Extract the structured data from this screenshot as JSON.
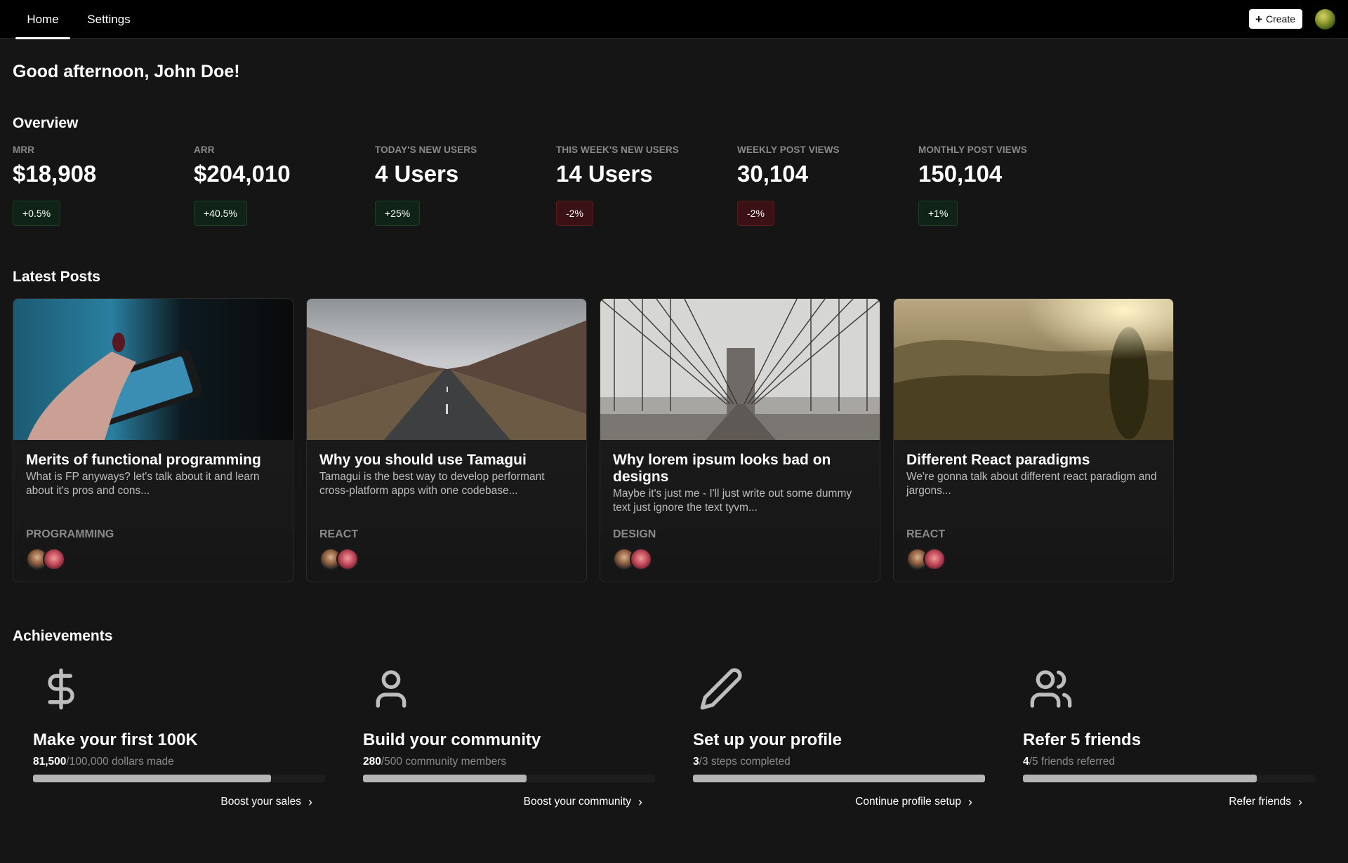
{
  "nav": {
    "tabs": [
      {
        "label": "Home",
        "active": true
      },
      {
        "label": "Settings",
        "active": false
      }
    ],
    "create_label": "Create",
    "create_icon": "plus-icon"
  },
  "greeting": "Good afternoon, John Doe!",
  "overview": {
    "title": "Overview",
    "stats": [
      {
        "label": "MRR",
        "value": "$18,908",
        "change": "+0.5%",
        "trend": "positive"
      },
      {
        "label": "ARR",
        "value": "$204,010",
        "change": "+40.5%",
        "trend": "positive"
      },
      {
        "label": "TODAY'S NEW USERS",
        "value": "4 Users",
        "change": "+25%",
        "trend": "positive"
      },
      {
        "label": "THIS WEEK'S NEW USERS",
        "value": "14 Users",
        "change": "-2%",
        "trend": "negative"
      },
      {
        "label": "WEEKLY POST VIEWS",
        "value": "30,104",
        "change": "-2%",
        "trend": "negative"
      },
      {
        "label": "MONTHLY POST VIEWS",
        "value": "150,104",
        "change": "+1%",
        "trend": "positive"
      }
    ]
  },
  "posts": {
    "title": "Latest Posts",
    "items": [
      {
        "title": "Merits of functional programming",
        "description": "What is FP anyways? let's talk about it and learn about it's pros and cons...",
        "tag": "PROGRAMMING",
        "image": "phone-photo"
      },
      {
        "title": "Why you should use Tamagui",
        "description": "Tamagui is the best way to develop performant cross-platform apps with one codebase...",
        "tag": "REACT",
        "image": "road-photo"
      },
      {
        "title": "Why lorem ipsum looks bad on designs",
        "description": "Maybe it's just me - I'll just write out some dummy text just ignore the text tyvm...",
        "tag": "DESIGN",
        "image": "bridge-photo"
      },
      {
        "title": "Different React paradigms",
        "description": "We're gonna talk about different react paradigm and jargons...",
        "tag": "REACT",
        "image": "landscape-photo"
      }
    ]
  },
  "achievements": {
    "title": "Achievements",
    "items": [
      {
        "icon": "dollar-icon",
        "title": "Make your first 100K",
        "current": "81,500",
        "total": "/100,000 dollars made",
        "progress": 0.815,
        "link": "Boost your sales"
      },
      {
        "icon": "user-icon",
        "title": "Build your community",
        "current": "280",
        "total": "/500 community members",
        "progress": 0.56,
        "link": "Boost your community"
      },
      {
        "icon": "pencil-icon",
        "title": "Set up your profile",
        "current": "3",
        "total": "/3 steps completed",
        "progress": 1.0,
        "link": "Continue profile setup"
      },
      {
        "icon": "users-icon",
        "title": "Refer 5 friends",
        "current": "4",
        "total": "/5 friends referred",
        "progress": 0.8,
        "link": "Refer friends"
      }
    ]
  },
  "colors": {
    "background": "#151515",
    "topbar": "#000000",
    "positive_badge": "#0f2417",
    "negative_badge": "#3a1115",
    "progress_fill": "#b5b5b5"
  }
}
